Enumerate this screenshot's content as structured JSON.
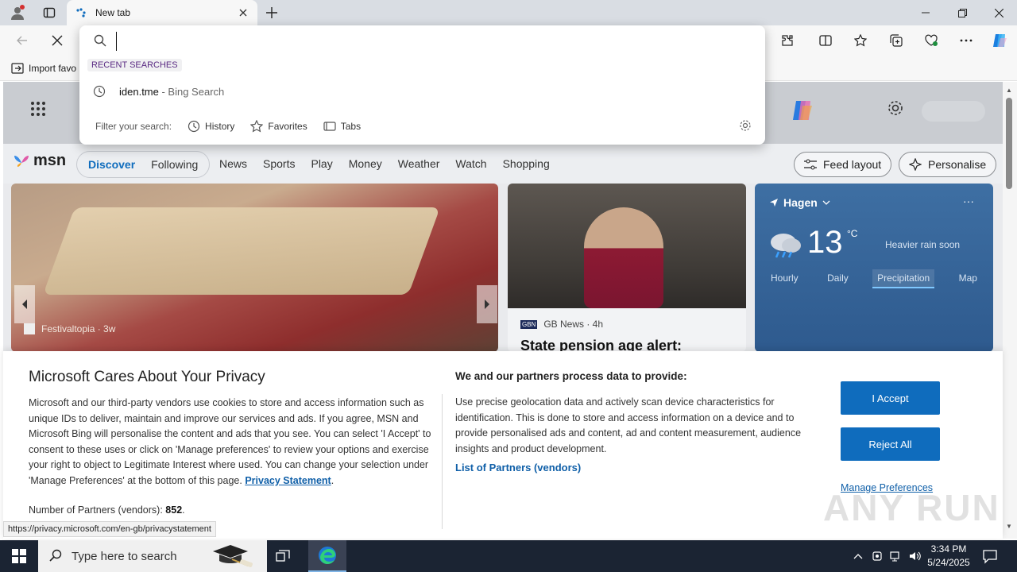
{
  "browser": {
    "tab_title": "New tab",
    "favorites_import": "Import favo"
  },
  "omnibox": {
    "input_value": "",
    "recent_label": "RECENT SEARCHES",
    "suggestion_main": "iden.tme",
    "suggestion_sub": " - Bing Search",
    "filter_label": "Filter your search:",
    "filters": [
      "History",
      "Favorites",
      "Tabs"
    ]
  },
  "msn": {
    "logo": "msn",
    "pills": [
      "Discover",
      "Following"
    ],
    "nav": [
      "News",
      "Sports",
      "Play",
      "Money",
      "Weather",
      "Watch",
      "Shopping"
    ],
    "feed_layout": "Feed layout",
    "personalise": "Personalise",
    "hero_source": "Festivaltopia · 3w",
    "news_source": "GB News · 4h",
    "news_badge": "GBN",
    "news_headline": "State pension age alert:",
    "weather": {
      "location": "Hagen",
      "temp": "13",
      "unit": "°C",
      "note": "Heavier rain soon",
      "tabs": [
        "Hourly",
        "Daily",
        "Precipitation",
        "Map"
      ],
      "active_tab": "Precipitation"
    }
  },
  "privacy": {
    "title": "Microsoft Cares About Your Privacy",
    "body": "Microsoft and our third-party vendors use cookies to store and access information such as unique IDs to deliver, maintain and improve our services and ads. If you agree, MSN and Microsoft Bing will personalise the content and ads that you see. You can select 'I Accept' to consent to these uses or click on 'Manage preferences' to review your options and exercise your right to object to Legitimate Interest where used.  You can change your selection under 'Manage Preferences' at the bottom of this page.",
    "statement_link": "Privacy Statement",
    "partners_label": "Number of Partners (vendors):",
    "partners_count": "852",
    "h2": "We and our partners process data to provide:",
    "body2": "Use precise geolocation data and actively scan device characteristics for identification. This is done to store and access information on a device and to provide personalised ads and content, ad and content measurement, audience insights and product development.",
    "partners_link": "List of Partners (vendors)",
    "accept": "I Accept",
    "reject": "Reject All",
    "manage": "Manage Preferences"
  },
  "status_url": "https://privacy.microsoft.com/en-gb/privacystatement",
  "watermark": "ANY RUN",
  "taskbar": {
    "search_placeholder": "Type here to search",
    "time": "3:34 PM",
    "date": "5/24/2025"
  }
}
